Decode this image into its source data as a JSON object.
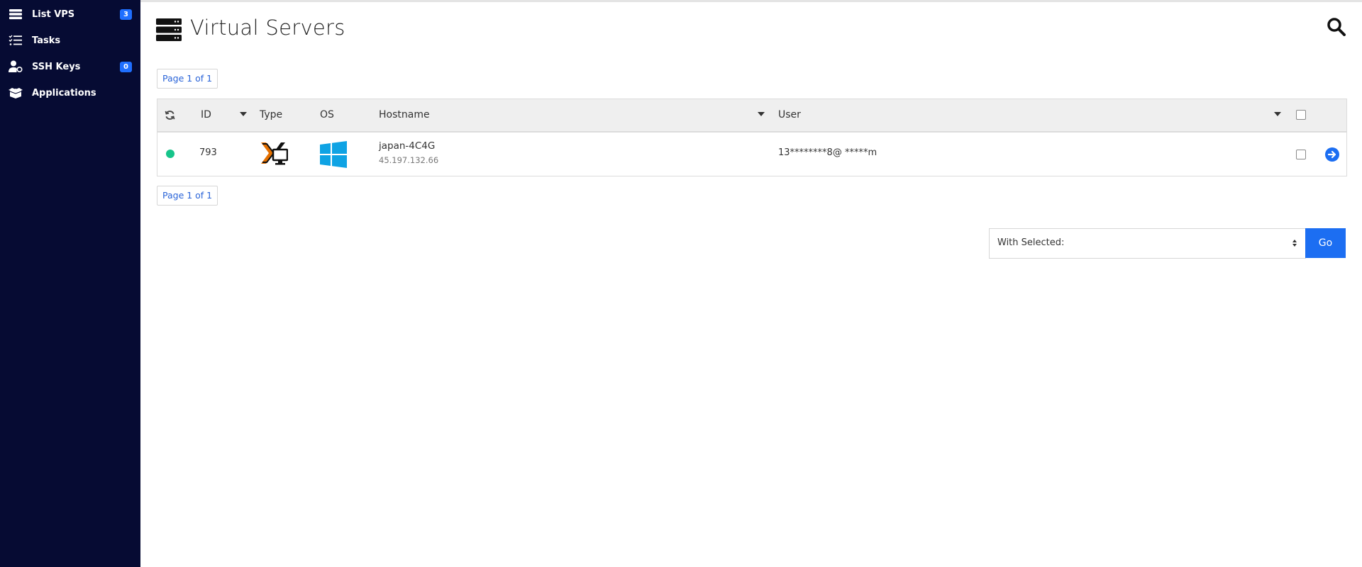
{
  "sidebar": {
    "items": [
      {
        "label": "List VPS",
        "icon": "server-list-icon",
        "badge": "3"
      },
      {
        "label": "Tasks",
        "icon": "tasks-icon",
        "badge": ""
      },
      {
        "label": "SSH Keys",
        "icon": "ssh-key-user-icon",
        "badge": "0"
      },
      {
        "label": "Applications",
        "icon": "applications-box-icon",
        "badge": ""
      }
    ]
  },
  "header": {
    "title": "Virtual Servers",
    "title_icon": "server-stack-icon",
    "search_icon": "search-icon"
  },
  "pagination": {
    "top": "Page 1 of 1",
    "bottom": "Page 1 of 1"
  },
  "table": {
    "columns": {
      "id": "ID",
      "type": "Type",
      "os": "OS",
      "hostname": "Hostname",
      "user": "User"
    },
    "rows": [
      {
        "status": "online",
        "status_color": "#17c48a",
        "id": "793",
        "type_icon": "proxmox-virtualization-icon",
        "os_icon": "windows-logo-icon",
        "hostname": "japan-4C4G",
        "ip": "45.197.132.66",
        "user": "13********8@ *****m"
      }
    ]
  },
  "actions": {
    "select_value": "With Selected:",
    "go_label": "Go"
  },
  "colors": {
    "sidebar_bg": "#060b33",
    "badge": "#1f6fff",
    "accent": "#1c6ef2",
    "link": "#2a64d8",
    "status_online": "#17c48a"
  }
}
